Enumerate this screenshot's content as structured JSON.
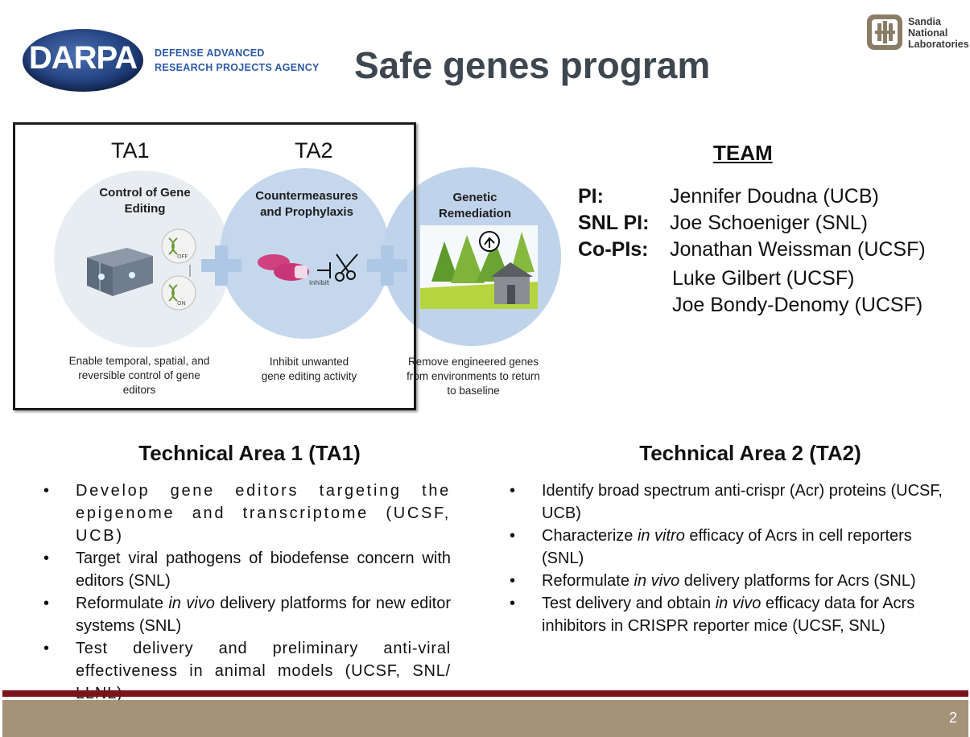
{
  "header": {
    "darpa_logo_text": "DARPA",
    "agency_line1": "DEFENSE ADVANCED",
    "agency_line2": "RESEARCH PROJECTS AGENCY",
    "title": "Safe genes program",
    "sandia_line1": "Sandia",
    "sandia_line2": "National",
    "sandia_line3": "Laboratories"
  },
  "figure": {
    "ta1_label": "TA1",
    "ta2_label": "TA2",
    "circle1": {
      "title_line1": "Control of Gene",
      "title_line2": "Editing",
      "off": "OFF",
      "on": "ON",
      "desc_line1": "Enable temporal, spatial, and",
      "desc_line2": "reversible control of gene",
      "desc_line3": "editors"
    },
    "circle2": {
      "title_line1": "Countermeasures",
      "title_line2": "and Prophylaxis",
      "inhibit": "inhibit",
      "desc_line1": "Inhibit unwanted",
      "desc_line2": "gene editing activity"
    },
    "circle3": {
      "title_line1": "Genetic",
      "title_line2": "Remediation",
      "desc_line1": "Remove engineered genes",
      "desc_line2": "from environments to return",
      "desc_line3": "to baseline"
    }
  },
  "team": {
    "heading": "TEAM",
    "members": [
      {
        "role": "PI:",
        "name": "Jennifer Doudna (UCB)"
      },
      {
        "role": "SNL PI:",
        "name": "Joe Schoeniger (SNL)"
      },
      {
        "role": "Co-PIs:",
        "name": "Jonathan Weissman (UCSF)"
      },
      {
        "role": "",
        "name": "Luke Gilbert (UCSF)"
      },
      {
        "role": "",
        "name": "Joe Bondy-Denomy (UCSF)"
      }
    ]
  },
  "ta1": {
    "title": "Technical Area 1 (TA1)",
    "bullet": "•",
    "items": [
      {
        "text": "Develop gene editors targeting the epigenome and transcriptome (UCSF, UCB)"
      },
      {
        "text": "Target viral pathogens of biodefense concern with editors (SNL)"
      },
      {
        "pre": "Reformulate ",
        "em": "in vivo",
        "post": " delivery platforms for new editor systems (SNL)"
      },
      {
        "text": "Test delivery and preliminary anti-viral effectiveness in animal models (UCSF, SNL/ LLNL)"
      }
    ]
  },
  "ta2": {
    "title": "Technical Area 2 (TA2)",
    "bullet": "•",
    "items": [
      {
        "text": "Identify broad spectrum anti-crispr (Acr) proteins (UCSF, UCB)"
      },
      {
        "pre": "Characterize ",
        "em": "in vitro",
        "post": " efficacy of Acrs in cell reporters (SNL)"
      },
      {
        "pre": "Reformulate ",
        "em": "in vivo",
        "post": " delivery platforms for Acrs (SNL)"
      },
      {
        "pre": "Test delivery and obtain ",
        "em": "in vivo",
        "post": " efficacy data for Acrs inhibitors in CRISPR reporter mice (UCSF, SNL)"
      }
    ]
  },
  "footer": {
    "page_number": "2"
  }
}
